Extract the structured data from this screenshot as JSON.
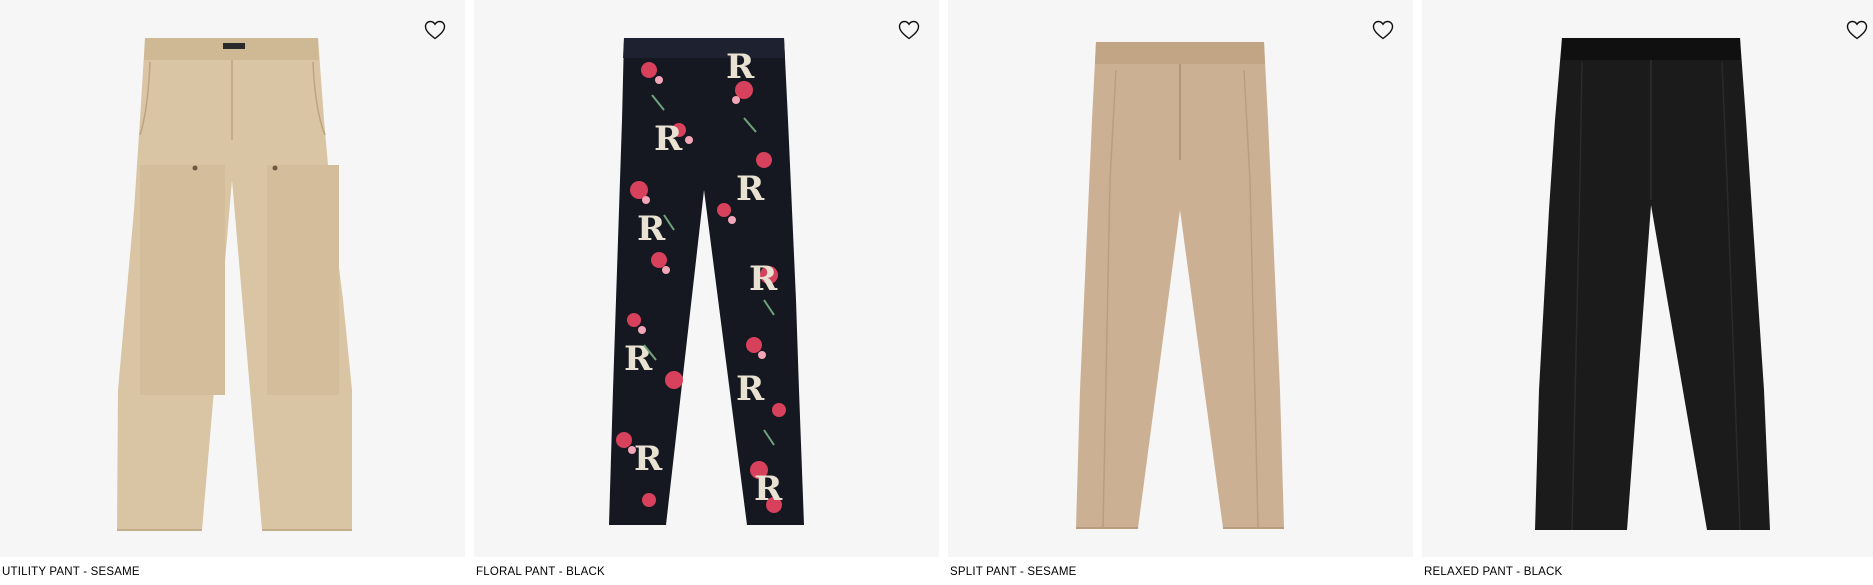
{
  "products": [
    {
      "title": "UTILITY PANT - SESAME",
      "image_icon": "utility-pant-sesame-image",
      "wishlist_icon": "heart-outline-icon",
      "color": "#d9c4a4"
    },
    {
      "title": "FLORAL PANT - BLACK",
      "image_icon": "floral-pant-black-image",
      "wishlist_icon": "heart-outline-icon",
      "color": "#151820"
    },
    {
      "title": "SPLIT PANT - SESAME",
      "image_icon": "split-pant-sesame-image",
      "wishlist_icon": "heart-outline-icon",
      "color": "#cbb094"
    },
    {
      "title": "RELAXED PANT - BLACK",
      "image_icon": "relaxed-pant-black-image",
      "wishlist_icon": "heart-outline-icon",
      "color": "#1b1b1b"
    }
  ],
  "colors": {
    "image_background": "#f6f6f6",
    "page_background": "#ffffff",
    "text": "#000000"
  }
}
